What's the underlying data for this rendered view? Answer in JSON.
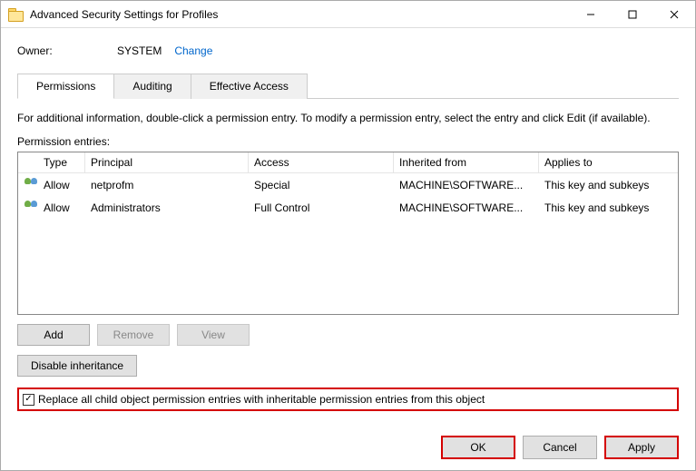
{
  "window": {
    "title": "Advanced Security Settings for Profiles"
  },
  "owner": {
    "label": "Owner:",
    "value": "SYSTEM",
    "change": "Change"
  },
  "tabs": {
    "permissions": "Permissions",
    "auditing": "Auditing",
    "effective": "Effective Access"
  },
  "info_text": "For additional information, double-click a permission entry. To modify a permission entry, select the entry and click Edit (if available).",
  "entries_label": "Permission entries:",
  "columns": {
    "type": "Type",
    "principal": "Principal",
    "access": "Access",
    "inherited": "Inherited from",
    "applies": "Applies to"
  },
  "rows": [
    {
      "type": "Allow",
      "principal": "netprofm",
      "access": "Special",
      "inherited": "MACHINE\\SOFTWARE...",
      "applies": "This key and subkeys"
    },
    {
      "type": "Allow",
      "principal": "Administrators",
      "access": "Full Control",
      "inherited": "MACHINE\\SOFTWARE...",
      "applies": "This key and subkeys"
    }
  ],
  "buttons": {
    "add": "Add",
    "remove": "Remove",
    "view": "View",
    "disable_inheritance": "Disable inheritance",
    "ok": "OK",
    "cancel": "Cancel",
    "apply": "Apply"
  },
  "checkbox": {
    "checked_glyph": "✓",
    "label": "Replace all child object permission entries with inheritable permission entries from this object"
  }
}
